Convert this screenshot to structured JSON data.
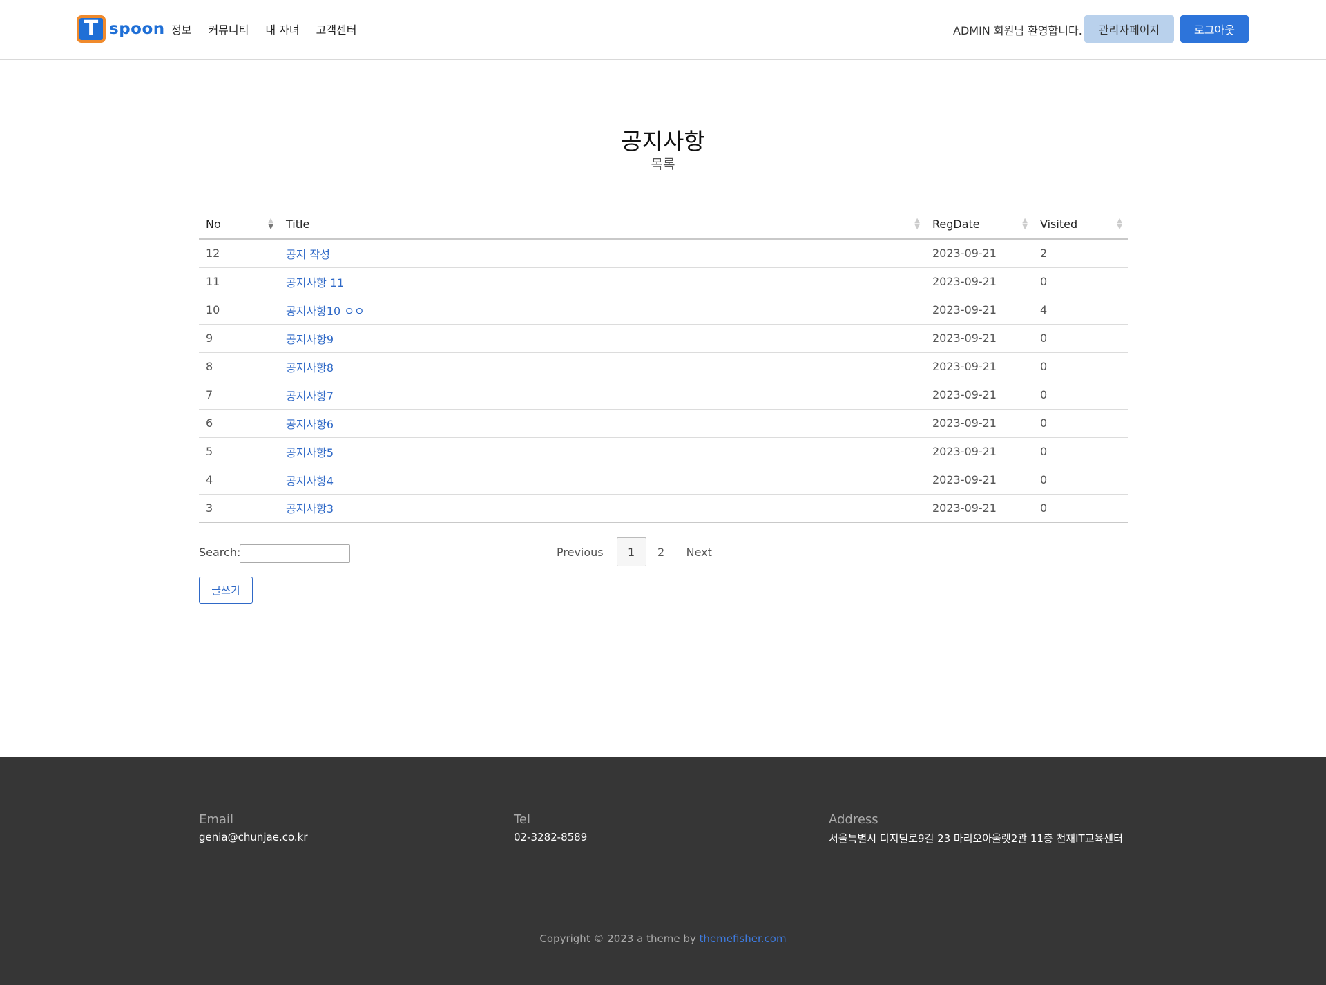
{
  "header": {
    "logo_letter": "T",
    "logo_text": "spoon",
    "nav": [
      "정보",
      "커뮤니티",
      "내 자녀",
      "고객센터"
    ],
    "welcome": "ADMIN 회원님 환영합니다.",
    "admin_button": "관리자페이지",
    "logout_button": "로그아웃"
  },
  "page": {
    "title": "공지사항",
    "subtitle": "목록"
  },
  "table": {
    "columns": [
      "No",
      "Title",
      "RegDate",
      "Visited"
    ],
    "rows": [
      {
        "no": "12",
        "title": "공지 작성",
        "date": "2023-09-21",
        "visited": "2"
      },
      {
        "no": "11",
        "title": "공지사항 11",
        "date": "2023-09-21",
        "visited": "0"
      },
      {
        "no": "10",
        "title": "공지사항10 ㅇㅇ",
        "date": "2023-09-21",
        "visited": "4"
      },
      {
        "no": "9",
        "title": "공지사항9",
        "date": "2023-09-21",
        "visited": "0"
      },
      {
        "no": "8",
        "title": "공지사항8",
        "date": "2023-09-21",
        "visited": "0"
      },
      {
        "no": "7",
        "title": "공지사항7",
        "date": "2023-09-21",
        "visited": "0"
      },
      {
        "no": "6",
        "title": "공지사항6",
        "date": "2023-09-21",
        "visited": "0"
      },
      {
        "no": "5",
        "title": "공지사항5",
        "date": "2023-09-21",
        "visited": "0"
      },
      {
        "no": "4",
        "title": "공지사항4",
        "date": "2023-09-21",
        "visited": "0"
      },
      {
        "no": "3",
        "title": "공지사항3",
        "date": "2023-09-21",
        "visited": "0"
      }
    ]
  },
  "search": {
    "label": "Search:",
    "value": ""
  },
  "pagination": {
    "previous": "Previous",
    "pages": [
      "1",
      "2"
    ],
    "current": "1",
    "next": "Next"
  },
  "write_button": "글쓰기",
  "footer": {
    "email_label": "Email",
    "email_value": "genia@chunjae.co.kr",
    "tel_label": "Tel",
    "tel_value": "02-3282-8589",
    "address_label": "Address",
    "address_value": "서울특별시 디지털로9길 23 마리오아울렛2관 11층 천재IT교육센터",
    "copyright_text": "Copyright © 2023 a theme by ",
    "copyright_link": "themefisher.com"
  },
  "colors": {
    "brand_blue": "#2d74da",
    "logo_orange": "#f08a2c",
    "link_blue": "#2f69c7",
    "footer_bg": "#363636"
  }
}
